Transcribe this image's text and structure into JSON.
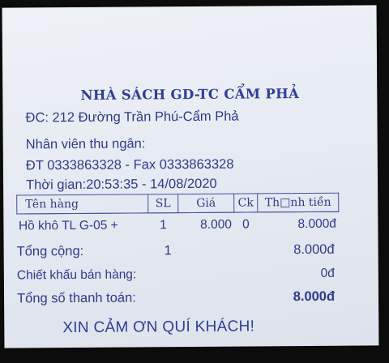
{
  "store": {
    "name": "NHÀ SÁCH GD-TC CẨM PHẢ",
    "address": "ĐC: 212 Đường Trần Phú-Cẩm Phả",
    "cashier_label": "Nhân viên thu ngân:",
    "phone_fax": "ĐT 0333863328 - Fax 0333863328",
    "datetime": "Thời gian:20:53:35 - 14/08/2020"
  },
  "table": {
    "headers": {
      "name": "Tên hàng",
      "qty": "SL",
      "price": "Giá",
      "discount": "Ck",
      "amount": "Th□nh tiền"
    },
    "rows": [
      {
        "name": "Hồ khô TL G-05 +",
        "qty": "1",
        "price": "8.000",
        "discount": "0",
        "amount": "8.000đ"
      }
    ]
  },
  "summary": {
    "total_label": "Tổng cộng:",
    "total_qty": "1",
    "total_value": "8.000đ",
    "discount_label": "Chiết khấu bán hàng:",
    "discount_value": "0đ",
    "payable_label": "Tổng số thanh toán:",
    "payable_value": "8.000đ"
  },
  "footer": {
    "thanks": "XIN CẢM ƠN QUÍ KHÁCH!"
  },
  "colors": {
    "ink": "#2f3a8c",
    "paper": "#e6eaf2",
    "background": "#0d0d0d"
  }
}
